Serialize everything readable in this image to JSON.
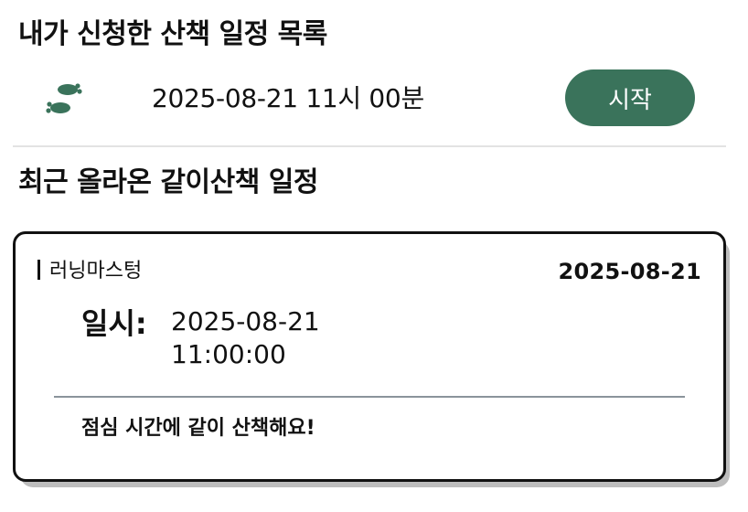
{
  "my_schedules": {
    "title": "내가 신청한 산책 일정 목록",
    "items": [
      {
        "icon": "footprints-icon",
        "datetime": "2025-08-21 11시 00분",
        "button_label": "시작"
      }
    ]
  },
  "recent": {
    "title": "최근 올라온 같이산책 일정",
    "cards": [
      {
        "author": "러닝마스텅",
        "date": "2025-08-21",
        "when_label": "일시:",
        "when_date": "2025-08-21",
        "when_time": "11:00:00",
        "message": "점심 시간에 같이 산책해요!"
      }
    ]
  },
  "colors": {
    "accent": "#3a735b",
    "card_border": "#111111",
    "card_shadow": "#bdbdbd",
    "divider": "#e3e3e3"
  }
}
